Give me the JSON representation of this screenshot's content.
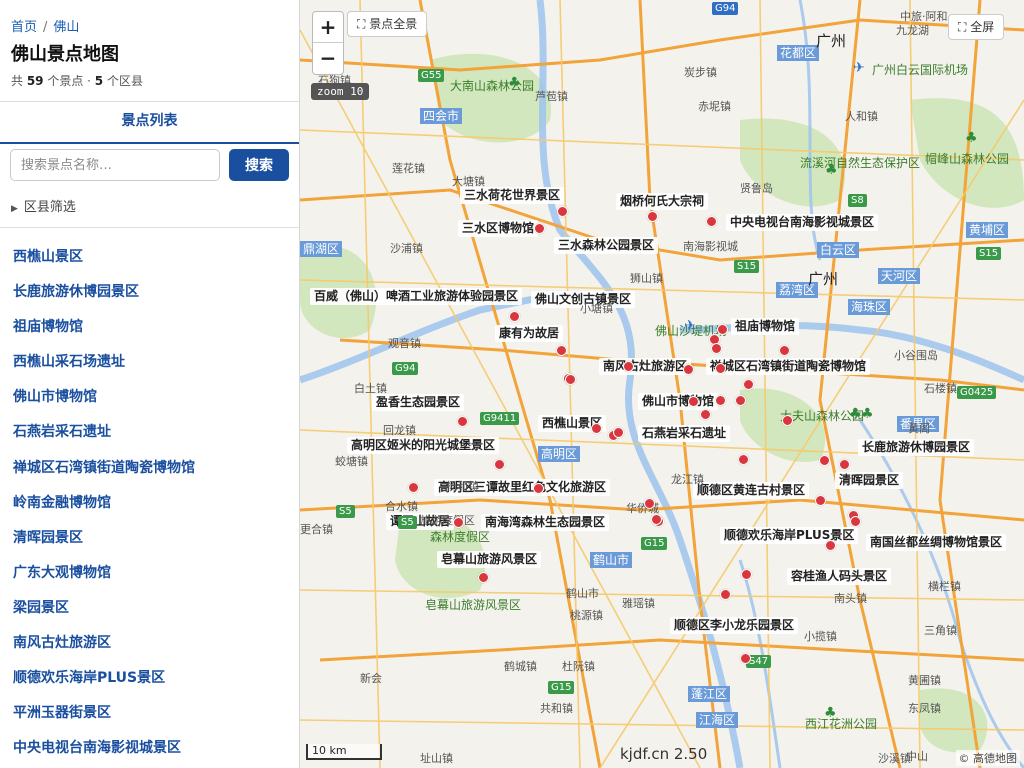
{
  "breadcrumb": {
    "home": "首页",
    "sep": "/",
    "current": "佛山"
  },
  "title": "佛山景点地图",
  "stats": {
    "prefix": "共 ",
    "spots": "59",
    "spots_unit": " 个景点 · ",
    "districts": "5",
    "districts_unit": " 个区县"
  },
  "tab": "景点列表",
  "search": {
    "placeholder": "搜索景点名称…",
    "button": "搜索"
  },
  "district_filter": "区县筛选",
  "spot_list": [
    "西樵山景区",
    "长鹿旅游休博园景区",
    "祖庙博物馆",
    "西樵山采石场遗址",
    "佛山市博物馆",
    "石燕岩采石遗址",
    "禅城区石湾镇街道陶瓷博物馆",
    "岭南金融博物馆",
    "清晖园景区",
    "广东大观博物馆",
    "梁园景区",
    "南风古灶旅游区",
    "顺德欢乐海岸PLUS景区",
    "平洲玉器街景区",
    "中央电视台南海影视城景区"
  ],
  "map": {
    "zoom_in": "+",
    "zoom_out": "−",
    "zoom_level": "zoom 10",
    "overview_button": "⛶ 景点全景",
    "fullscreen_button": "⛶ 全屏",
    "scale": "10 km",
    "site": "kjdf.cn 2.50",
    "attribution": "© 高德地图",
    "poi_labels": [
      "三水荷花世界景区",
      "烟桥何氏大宗祠",
      "中央电视台南海影视城景区",
      "三水区博物馆",
      "三水森林公园景区",
      "百威（佛山）啤酒工业旅游体验园景区",
      "佛山文创古镇景区",
      "康有为故居",
      "祖庙博物馆",
      "南风古灶旅游区",
      "禅城区石湾镇街道陶瓷博物馆",
      "盈香生态园景区",
      "佛山市博物馆",
      "西樵山景区",
      "石燕岩采石遗址",
      "高明区姬米的阳光城堡景区",
      "长鹿旅游休博园景区",
      "清晖园景区",
      "顺德区黄连古村景区",
      "高明区三谭故里红色文化旅游区",
      "谭平山故居",
      "南海湾森林生态园景区",
      "顺德欢乐海岸PLUS景区",
      "南国丝都丝绸博物馆景区",
      "皂幕山旅游风景区",
      "容桂渔人码头景区",
      "顺德区李小龙乐园景区"
    ],
    "district_labels": [
      "四会市",
      "花都区",
      "白云区",
      "鼎湖区",
      "荔湾区",
      "天河区",
      "海珠区",
      "黄埔区",
      "高明区",
      "番禺区",
      "鹤山市",
      "江海区",
      "蓬江区"
    ],
    "green_labels": [
      "大南山森林公园",
      "流溪河自然生态保护区",
      "帽峰山森林公园",
      "大夫山森林公园",
      "皂幕山旅游风景区",
      "西江花洲公园",
      "森林度假区",
      "佛山沙堤机场",
      "广州白云国际机场"
    ],
    "place_labels": [
      "石狗镇",
      "芦苞镇",
      "炭步镇",
      "赤坭镇",
      "人和镇",
      "莲花镇",
      "大塘镇",
      "南海影视城",
      "贤鲁岛",
      "沙浦镇",
      "狮山镇",
      "小塘镇",
      "观音镇",
      "白土镇",
      "回龙镇",
      "蛟塘镇",
      "杨和镇",
      "合水镇",
      "更合镇",
      "龙江镇",
      "华侨城",
      "鹤山市",
      "址山镇",
      "雅瑶镇",
      "桃源镇",
      "鹤城镇",
      "杜阮镇",
      "共和镇",
      "横栏镇",
      "小揽镇",
      "南头镇",
      "黄圃镇",
      "三角镇",
      "东凤镇",
      "沙溪镇",
      "新会",
      "小谷围岛",
      "石楼镇",
      "黄阁",
      "旅游度假区",
      "中山",
      "广州",
      "九龙湖",
      "中旅·阿和",
      "广州"
    ],
    "road_shields": [
      "G94",
      "G55",
      "S8",
      "S15",
      "S15",
      "G0425",
      "G94",
      "G9411",
      "S5",
      "S5",
      "G15",
      "S47",
      "G15"
    ]
  }
}
